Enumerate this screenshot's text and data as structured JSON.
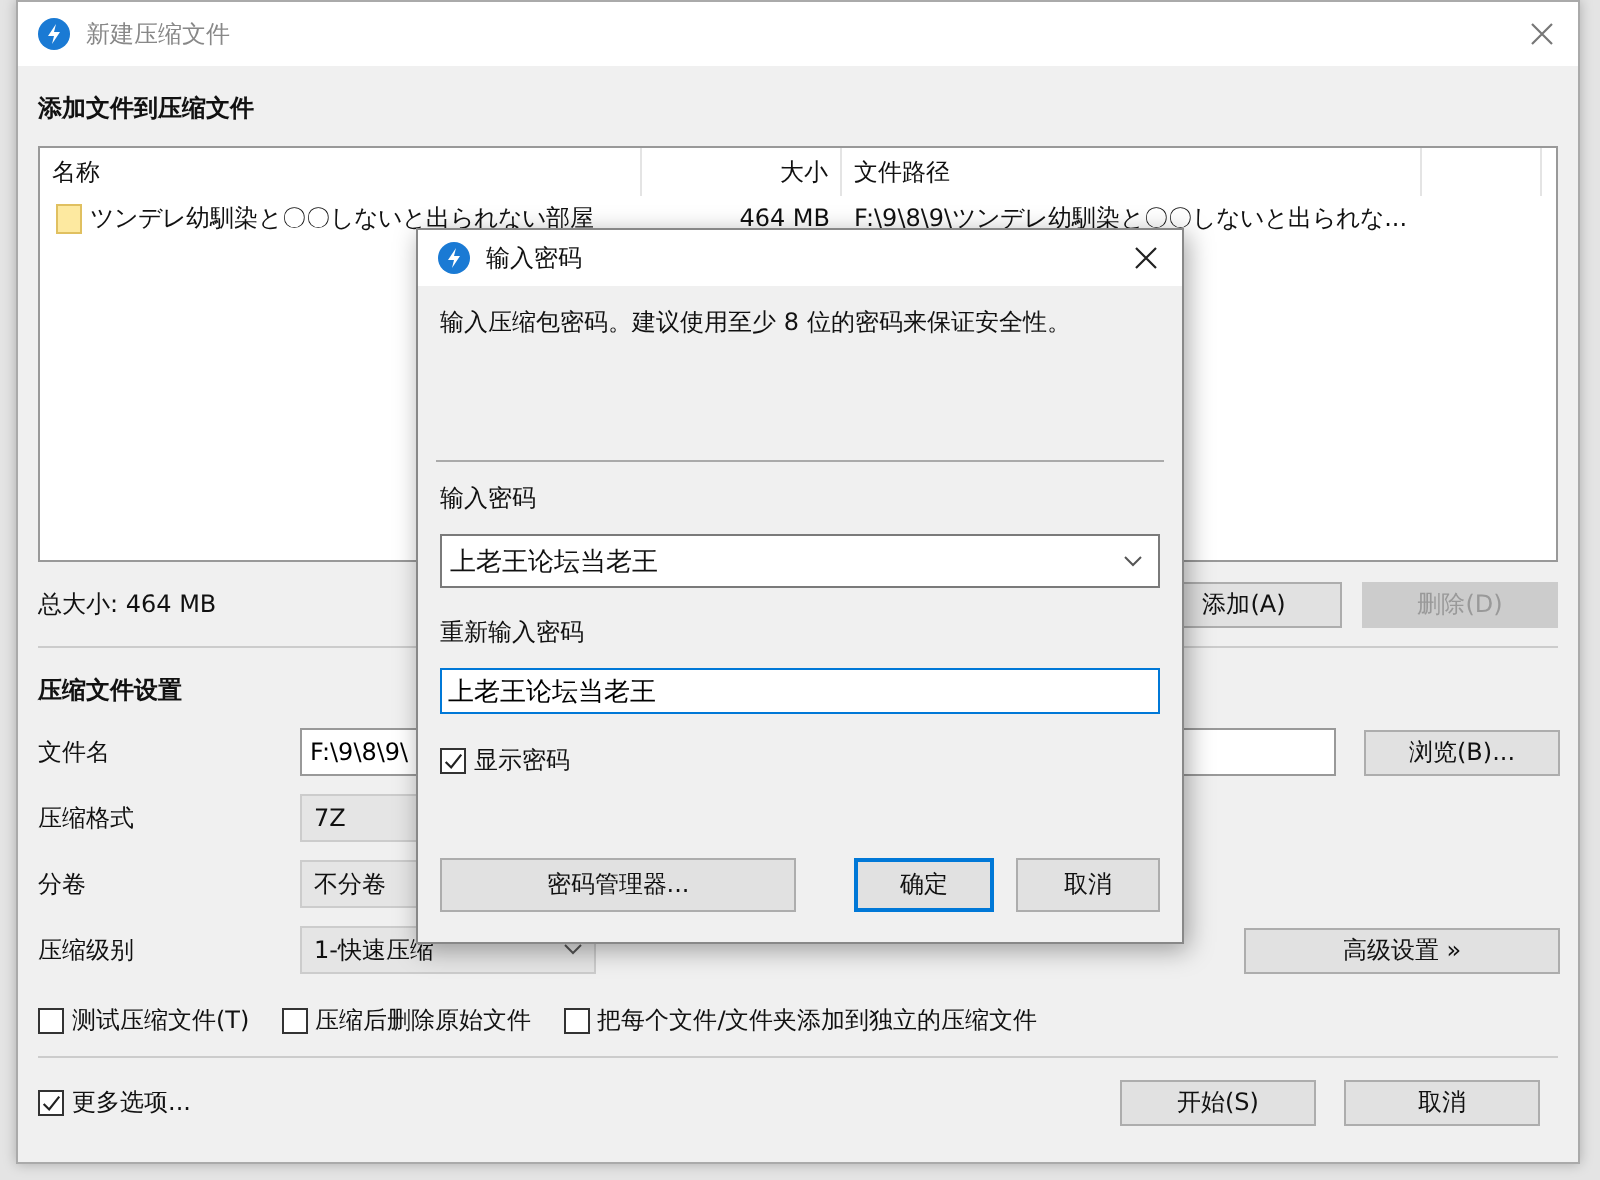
{
  "window": {
    "title": "新建压缩文件"
  },
  "files": {
    "heading": "添加文件到压缩文件",
    "columns": [
      {
        "label": "名称"
      },
      {
        "label": "大小"
      },
      {
        "label": "文件路径"
      }
    ],
    "rows": [
      {
        "name": "ツンデレ幼馴染と〇〇しないと出られない部屋",
        "size": "464 MB",
        "path": "F:\\9\\8\\9\\ツンデレ幼馴染と〇〇しないと出られな..."
      }
    ],
    "total_size": "总大小: 464 MB",
    "buttons": [
      {
        "label": "添加(A)",
        "disabled": false
      },
      {
        "label": "删除(D)",
        "disabled": true
      }
    ]
  },
  "settings": {
    "heading": "压缩文件设置",
    "filename": {
      "label": "文件名",
      "value": "F:\\9\\8\\9\\"
    },
    "browse_button": "浏览(B)...",
    "format": {
      "label": "压缩格式",
      "value": "7Z"
    },
    "split": {
      "label": "分卷",
      "value": "不分卷"
    },
    "level": {
      "label": "压缩级别",
      "value": "1-快速压缩"
    },
    "advanced_button": "高级设置 »",
    "options": [
      {
        "label": "测试压缩文件(T)",
        "checked": false
      },
      {
        "label": "压缩后删除原始文件",
        "checked": false
      },
      {
        "label": "把每个文件/文件夹添加到独立的压缩文件",
        "checked": false
      }
    ]
  },
  "more_options": {
    "label": "更多选项...",
    "checked": true
  },
  "footer_buttons": [
    {
      "label": "开始(S)"
    },
    {
      "label": "取消"
    }
  ],
  "dialog": {
    "title": "输入密码",
    "description": "输入压缩包密码。建议使用至少 8 位的密码来保证安全性。",
    "password_label": "输入密码",
    "password": "上老王论坛当老王",
    "confirm_label": "重新输入密码",
    "confirm": "上老王论坛当老王",
    "show_password": {
      "label": "显示密码",
      "checked": true
    },
    "manager_button": "密码管理器...",
    "ok_button": "确定",
    "cancel_button": "取消"
  }
}
